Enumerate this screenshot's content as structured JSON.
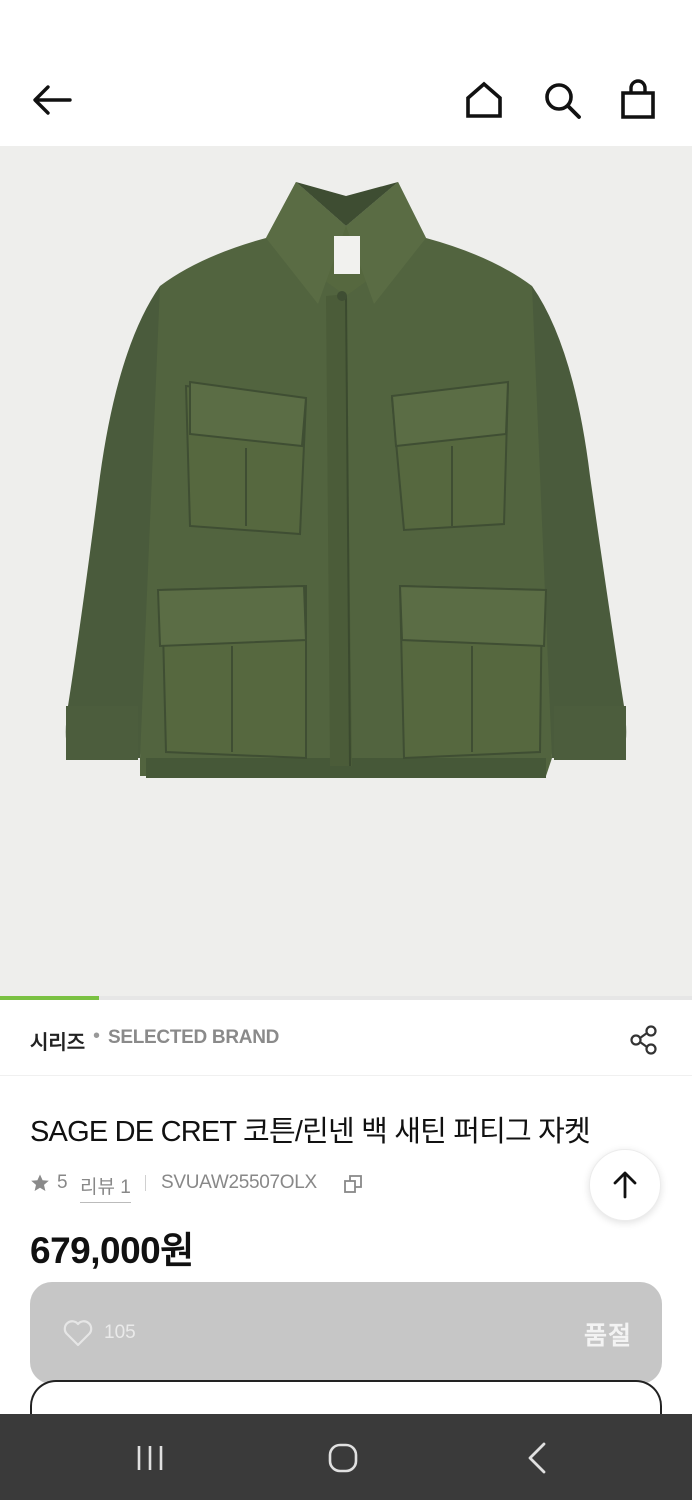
{
  "top_bar": {
    "back_icon": "arrow-left-icon",
    "home_icon": "home-icon",
    "search_icon": "search-icon",
    "bag_icon": "shopping-bag-icon"
  },
  "gallery": {
    "image_subject": "olive green cotton/linen field jacket",
    "progress": 0.143
  },
  "series": {
    "label": "시리즈",
    "separator": "•",
    "brand": "SELECTED BRAND",
    "share_icon": "share-icon"
  },
  "product": {
    "title": "SAGE DE CRET 코튼/린넨 백 새틴 퍼티그 자켓",
    "rating": "5",
    "review_label": "리뷰 1",
    "sku": "SVUAW25507OLX",
    "copy_icon": "copy-icon",
    "price": "679,000원"
  },
  "scroll_top_icon": "arrow-up-icon",
  "purchase_bar": {
    "heart_icon": "heart-outline-icon",
    "like_count": "105",
    "status_label": "품절"
  },
  "system_nav": {
    "recent_icon": "recent-apps-icon",
    "home_icon": "home-circle-icon",
    "back_icon": "chevron-left-icon"
  },
  "colors": {
    "accent": "#7ac142",
    "soldout_bg": "#c6c6c6",
    "jacket": "#4f6140",
    "hero_bg": "#eeeeec",
    "navbar_bg": "#3a3a3a"
  }
}
